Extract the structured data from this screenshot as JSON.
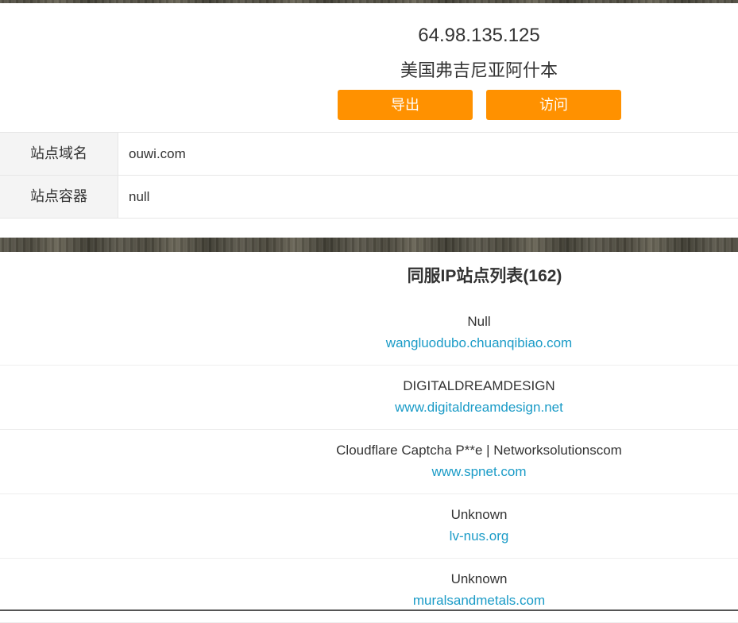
{
  "header": {
    "ip": "64.98.135.125",
    "location": "美国弗吉尼亚阿什本",
    "export_label": "导出",
    "visit_label": "访问"
  },
  "info": [
    {
      "label": "站点域名",
      "value": "ouwi.com"
    },
    {
      "label": "站点容器",
      "value": "null"
    }
  ],
  "site_list": {
    "title": "同服IP站点列表(162)",
    "items": [
      {
        "name": "Null",
        "url": "wangluodubo.chuanqibiao.com"
      },
      {
        "name": "DIGITALDREAMDESIGN",
        "url": "www.digitaldreamdesign.net"
      },
      {
        "name": "Cloudflare Captcha P**e | Networksolutionscom",
        "url": "www.spnet.com"
      },
      {
        "name": "Unknown",
        "url": "lv-nus.org"
      },
      {
        "name": "Unknown",
        "url": "muralsandmetals.com"
      }
    ]
  },
  "colors": {
    "button": "#ff9100",
    "link": "#1a9bc7",
    "label_bg": "#f4f4f4"
  }
}
